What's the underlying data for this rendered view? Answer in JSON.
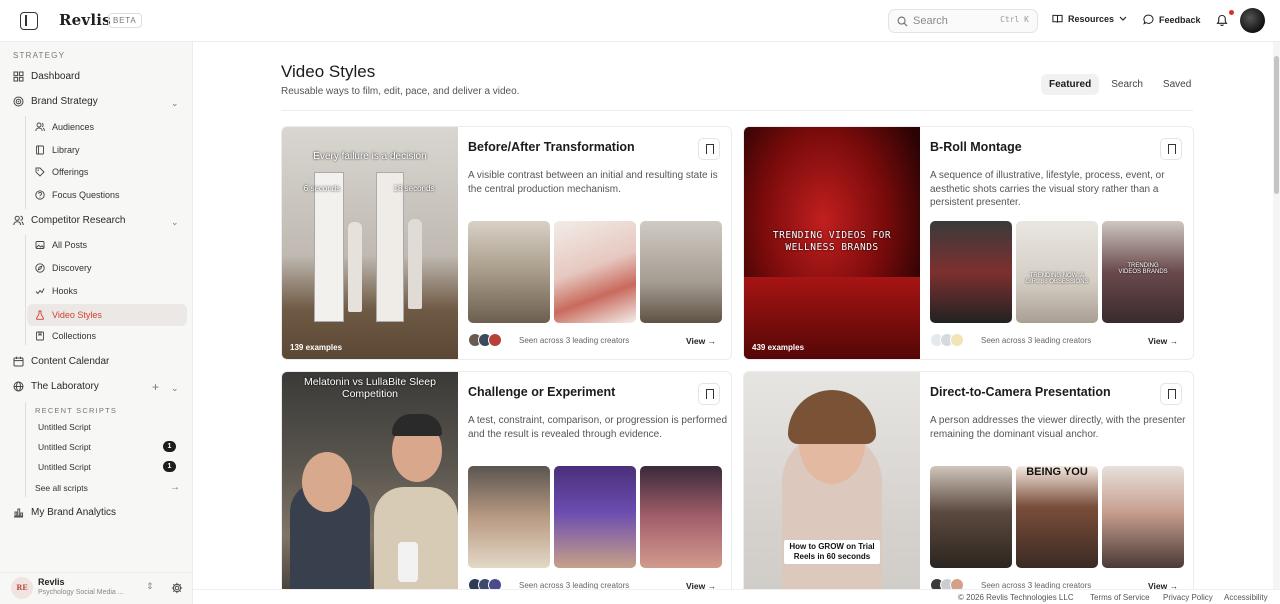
{
  "app": {
    "name": "Revlis",
    "badge": "BETA"
  },
  "header": {
    "search_placeholder": "Search",
    "search_shortcut": "Ctrl K",
    "resources": "Resources",
    "feedback": "Feedback"
  },
  "sidebar": {
    "section": "STRATEGY",
    "dashboard": "Dashboard",
    "brand_strategy": "Brand Strategy",
    "brand_items": [
      "Audiences",
      "Library",
      "Offerings",
      "Focus Questions"
    ],
    "competitor_research": "Competitor Research",
    "competitor_items": [
      "All Posts",
      "Discovery",
      "Hooks",
      "Video Styles",
      "Collections"
    ],
    "content_calendar": "Content Calendar",
    "laboratory": "The Laboratory",
    "recent_scripts_label": "RECENT SCRIPTS",
    "scripts": [
      {
        "name": "Untitled Script",
        "badge": ""
      },
      {
        "name": "Untitled Script",
        "badge": "1"
      },
      {
        "name": "Untitled Script",
        "badge": "1"
      }
    ],
    "see_all": "See all scripts",
    "analytics": "My Brand Analytics",
    "profile": {
      "initials": "RE",
      "name": "Revlis",
      "subtitle": "Psychology Social Media ..."
    }
  },
  "page": {
    "title": "Video Styles",
    "description": "Reusable ways to film, edit, pace, and deliver a video.",
    "tabs": [
      "Featured",
      "Search",
      "Saved"
    ]
  },
  "cards": [
    {
      "title": "Before/After Transformation",
      "description": "A visible contrast between an initial and resulting state is the central production mechanism.",
      "examples": "139 examples",
      "hero_caption": "Every failure is a decision",
      "hero_left": "6 seconds",
      "hero_right": "18 seconds",
      "seen": "Seen across 3 leading creators",
      "view": "View"
    },
    {
      "title": "B-Roll Montage",
      "description": "A sequence of illustrative, lifestyle, process, event, or aesthetic shots carries the visual story rather than a persistent presenter.",
      "examples": "439 examples",
      "hero_caption": "TRENDING VIDEOS FOR WELLNESS BRANDS",
      "thumb2_text": "TRENDING NOW: A GIRL 88 OBSESSIONS",
      "thumb3_text": "TRENDING VIDEOS BRANDS",
      "seen": "Seen across 3 leading creators",
      "view": "View"
    },
    {
      "title": "Challenge or Experiment",
      "description": "A test, constraint, comparison, or progression is performed and the result is revealed through evidence.",
      "hero_caption": "Melatonin vs LullaBite Sleep Competition",
      "seen": "Seen across 3 leading creators",
      "view": "View"
    },
    {
      "title": "Direct-to-Camera Presentation",
      "description": "A person addresses the viewer directly, with the presenter remaining the dominant visual anchor.",
      "hero_caption": "How to GROW on Trial Reels in 60 seconds",
      "thumb2_text": "BEING YOU",
      "seen": "Seen across 3 leading creators",
      "view": "View"
    }
  ],
  "footer": [
    "© 2026 Revlis Technologies LLC",
    "Terms of Service",
    "Privacy Policy",
    "Accessibility"
  ]
}
